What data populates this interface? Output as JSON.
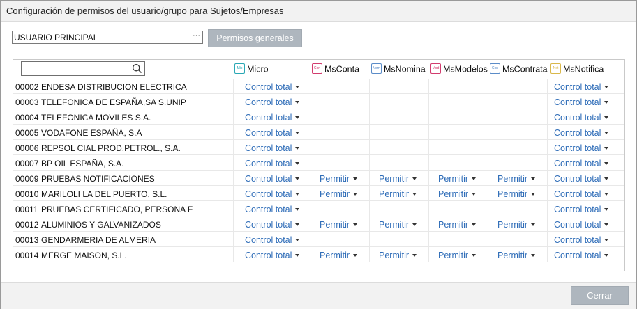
{
  "window": {
    "title": "Configuración de permisos del usuario/grupo para Sujetos/Empresas"
  },
  "user_selector": {
    "value": "USUARIO PRINCIPAL",
    "dots": "···"
  },
  "buttons": {
    "general_permissions": "Permisos generales",
    "close": "Cerrar"
  },
  "search": {
    "value": ""
  },
  "columns": [
    {
      "key": "micro",
      "label": "Micro",
      "badge": "Mic",
      "color": "#2aa8b5"
    },
    {
      "key": "msconta",
      "label": "MsConta",
      "badge": "Con",
      "color": "#d23c6e"
    },
    {
      "key": "msnomina",
      "label": "MsNomina",
      "badge": "Nom",
      "color": "#5b8cc8"
    },
    {
      "key": "msmodelos",
      "label": "MsModelos",
      "badge": "Mod",
      "color": "#d23c6e"
    },
    {
      "key": "mscontrata",
      "label": "MsContrata",
      "badge": "Con",
      "color": "#5b8cc8"
    },
    {
      "key": "msnotifica",
      "label": "MsNotifica",
      "badge": "Not",
      "color": "#d9b84a"
    }
  ],
  "companies": [
    {
      "code": "00002",
      "name": "ENDESA DISTRIBUCION ELECTRICA",
      "perms": [
        "Control total",
        "",
        "",
        "",
        "",
        "Control total"
      ]
    },
    {
      "code": "00003",
      "name": "TELEFONICA DE ESPAÑA,SA S.UNIP",
      "perms": [
        "Control total",
        "",
        "",
        "",
        "",
        "Control total"
      ]
    },
    {
      "code": "00004",
      "name": "TELEFONICA MOVILES  S.A.",
      "perms": [
        "Control total",
        "",
        "",
        "",
        "",
        "Control total"
      ]
    },
    {
      "code": "00005",
      "name": "VODAFONE ESPAÑA, S.A",
      "perms": [
        "Control total",
        "",
        "",
        "",
        "",
        "Control total"
      ]
    },
    {
      "code": "00006",
      "name": "REPSOL CIAL PROD.PETROL., S.A.",
      "perms": [
        "Control total",
        "",
        "",
        "",
        "",
        "Control total"
      ]
    },
    {
      "code": "00007",
      "name": "BP OIL ESPAÑA, S.A.",
      "perms": [
        "Control total",
        "",
        "",
        "",
        "",
        "Control total"
      ]
    },
    {
      "code": "00009",
      "name": "PRUEBAS NOTIFICACIONES",
      "perms": [
        "Control total",
        "Permitir",
        "Permitir",
        "Permitir",
        "Permitir",
        "Control total"
      ]
    },
    {
      "code": "00010",
      "name": "MARILOLI LA DEL PUERTO, S.L.",
      "perms": [
        "Control total",
        "Permitir",
        "Permitir",
        "Permitir",
        "Permitir",
        "Control total"
      ]
    },
    {
      "code": "00011",
      "name": "PRUEBAS CERTIFICADO, PERSONA F",
      "perms": [
        "Control total",
        "",
        "",
        "",
        "",
        "Control total"
      ]
    },
    {
      "code": "00012",
      "name": "ALUMINIOS Y GALVANIZADOS",
      "perms": [
        "Control total",
        "Permitir",
        "Permitir",
        "Permitir",
        "Permitir",
        "Control total"
      ]
    },
    {
      "code": "00013",
      "name": "GENDARMERIA DE ALMERIA",
      "perms": [
        "Control total",
        "",
        "",
        "",
        "",
        "Control total"
      ]
    },
    {
      "code": "00014",
      "name": "MERGE MAISON, S.L.",
      "perms": [
        "Control total",
        "Permitir",
        "Permitir",
        "Permitir",
        "Permitir",
        "Control total"
      ]
    }
  ]
}
